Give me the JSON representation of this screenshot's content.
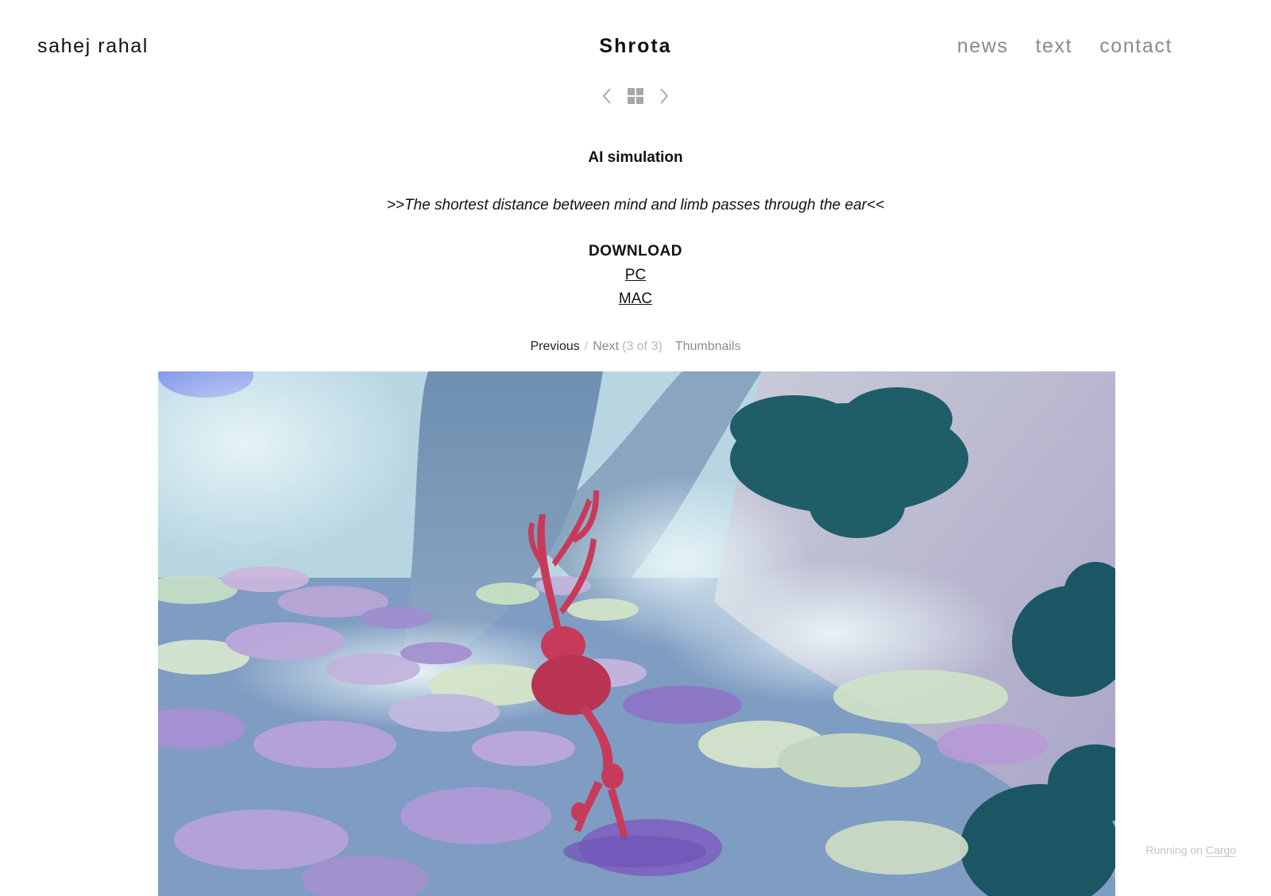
{
  "site": {
    "name": "sahej rahal"
  },
  "header": {
    "project_title": "Shrota"
  },
  "nav": {
    "items": [
      "news",
      "text",
      "contact"
    ]
  },
  "project_nav": {
    "prev_icon": "chevron-left-icon",
    "grid_icon": "grid-icon",
    "next_icon": "chevron-right-icon"
  },
  "content": {
    "subtitle": "AI simulation",
    "quote": ">>The shortest distance between mind and limb passes through the ear<<",
    "download_heading": "DOWNLOAD",
    "links": {
      "pc": "PC",
      "mac": "MAC"
    }
  },
  "slideshow": {
    "previous": "Previous",
    "separator": "/",
    "next": "Next",
    "count": "(3 of 3)",
    "thumbnails": "Thumbnails"
  },
  "hero_image": {
    "subject": "pink antlered deer creature in a pastel foggy landscape"
  },
  "footer": {
    "running_on": "Running on",
    "cargo": "Cargo"
  },
  "colors": {
    "nav_gray": "#8a8a8a",
    "creature_pink": "#c83a5a",
    "teal_tree": "#1d5a66"
  }
}
